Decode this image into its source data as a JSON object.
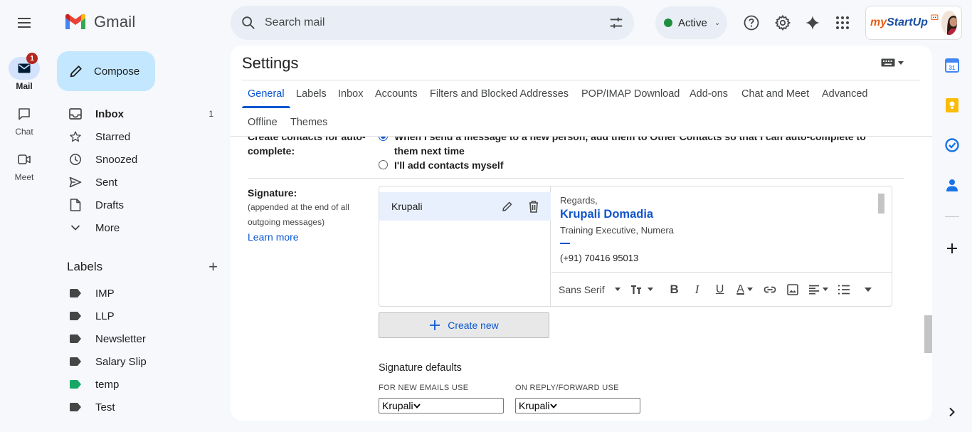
{
  "app": {
    "name": "Gmail"
  },
  "search": {
    "placeholder": "Search mail"
  },
  "status": {
    "label": "Active",
    "color": "#1e8e3e"
  },
  "account": {
    "brand_part1": "my",
    "brand_part2": "StartUp"
  },
  "rail": [
    {
      "label": "Mail",
      "badge": "1",
      "icon": "mail-icon"
    },
    {
      "label": "Chat",
      "icon": "chat-icon"
    },
    {
      "label": "Meet",
      "icon": "meet-icon"
    }
  ],
  "compose": {
    "label": "Compose"
  },
  "nav": [
    {
      "label": "Inbox",
      "count": "1",
      "icon": "inbox-icon"
    },
    {
      "label": "Starred",
      "icon": "star-icon"
    },
    {
      "label": "Snoozed",
      "icon": "clock-icon"
    },
    {
      "label": "Sent",
      "icon": "send-icon"
    },
    {
      "label": "Drafts",
      "icon": "draft-icon"
    },
    {
      "label": "More",
      "icon": "chevron-down-icon"
    }
  ],
  "labels": {
    "title": "Labels",
    "items": [
      {
        "label": "IMP",
        "color": "#444746"
      },
      {
        "label": "LLP",
        "color": "#444746"
      },
      {
        "label": "Newsletter",
        "color": "#444746"
      },
      {
        "label": "Salary Slip",
        "color": "#444746"
      },
      {
        "label": "temp",
        "color": "#16a765"
      },
      {
        "label": "Test",
        "color": "#444746"
      }
    ]
  },
  "settings": {
    "title": "Settings",
    "tabs": [
      "General",
      "Labels",
      "Inbox",
      "Accounts",
      "Filters and Blocked Addresses",
      "POP/IMAP Download",
      "Add-ons",
      "Chat and Meet",
      "Advanced",
      "Offline",
      "Themes"
    ],
    "contacts": {
      "label_line1": "Create contacts for auto-",
      "label_line2": "complete:",
      "option1_line1": "When I send a message to a new person, add them to Other Contacts so that I can auto-complete to",
      "option1_line2": "them next time",
      "option2": "I'll add contacts myself"
    },
    "signature": {
      "label": "Signature:",
      "note_line1": "(appended at the end of all",
      "note_line2": "outgoing messages)",
      "learn_more": "Learn more",
      "selected_name": "Krupali",
      "body": {
        "greeting": "Regards,",
        "name": "Krupali Domadia",
        "title": "Training Executive, Numera",
        "phone": "(+91) 70416 95013"
      },
      "toolbar_font": "Sans Serif",
      "create_new": "Create new",
      "defaults_title": "Signature defaults",
      "new_emails_caption": "FOR NEW EMAILS USE",
      "reply_caption": "ON REPLY/FORWARD USE",
      "new_emails_value": "Krupali",
      "reply_value": "Krupali"
    }
  }
}
